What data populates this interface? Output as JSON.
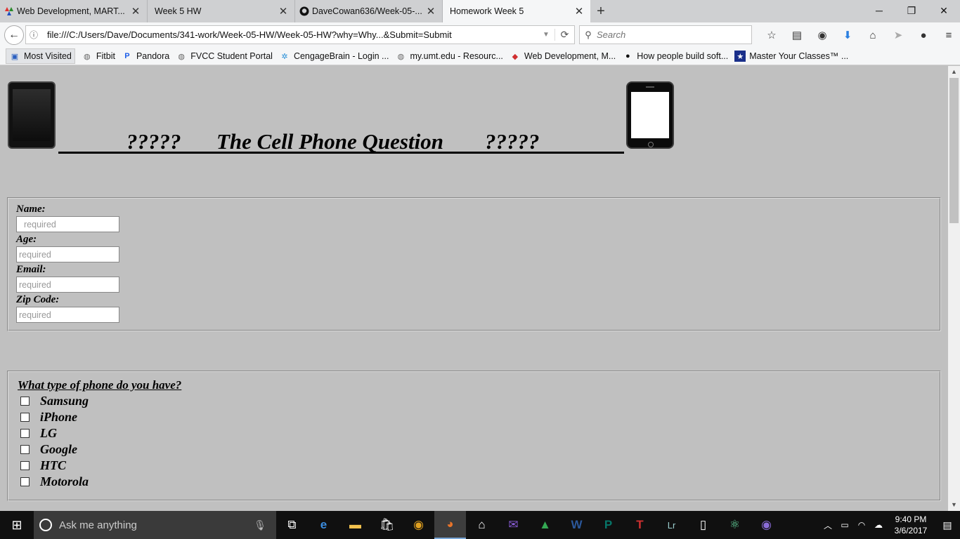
{
  "tabs": [
    {
      "label": "Web Development, MART...",
      "close": "✕"
    },
    {
      "label": "Week 5 HW",
      "close": "✕"
    },
    {
      "label": "DaveCowan636/Week-05-...",
      "close": "✕"
    },
    {
      "label": "Homework Week 5",
      "close": "✕"
    }
  ],
  "newtab": "+",
  "nav": {
    "url": "file:///C:/Users/Dave/Documents/341-work/Week-05-HW/Week-05-HW?why=Why...&Submit=Submit",
    "search_placeholder": "Search"
  },
  "bookmarks": [
    {
      "label": "Most Visited"
    },
    {
      "label": "Fitbit"
    },
    {
      "label": "Pandora"
    },
    {
      "label": "FVCC Student Portal"
    },
    {
      "label": "CengageBrain - Login ..."
    },
    {
      "label": "my.umt.edu - Resourc..."
    },
    {
      "label": "Web Development, M..."
    },
    {
      "label": "How people build soft..."
    },
    {
      "label": "Master Your Classes™ ..."
    }
  ],
  "page": {
    "heading_left": "?????",
    "heading_title": "The Cell Phone Question",
    "heading_right": "?????",
    "form": {
      "name_label": "Name:",
      "name_placeholder": "required",
      "age_label": "Age:",
      "age_placeholder": "required",
      "email_label": "Email:",
      "email_placeholder": "required",
      "zip_label": "Zip Code:",
      "zip_placeholder": "required"
    },
    "question": "What type of phone do you have?",
    "options": [
      "Samsung",
      "iPhone",
      "LG",
      "Google",
      "HTC",
      "Motorola"
    ]
  },
  "taskbar": {
    "search_placeholder": "Ask me anything",
    "time": "9:40 PM",
    "date": "3/6/2017"
  }
}
